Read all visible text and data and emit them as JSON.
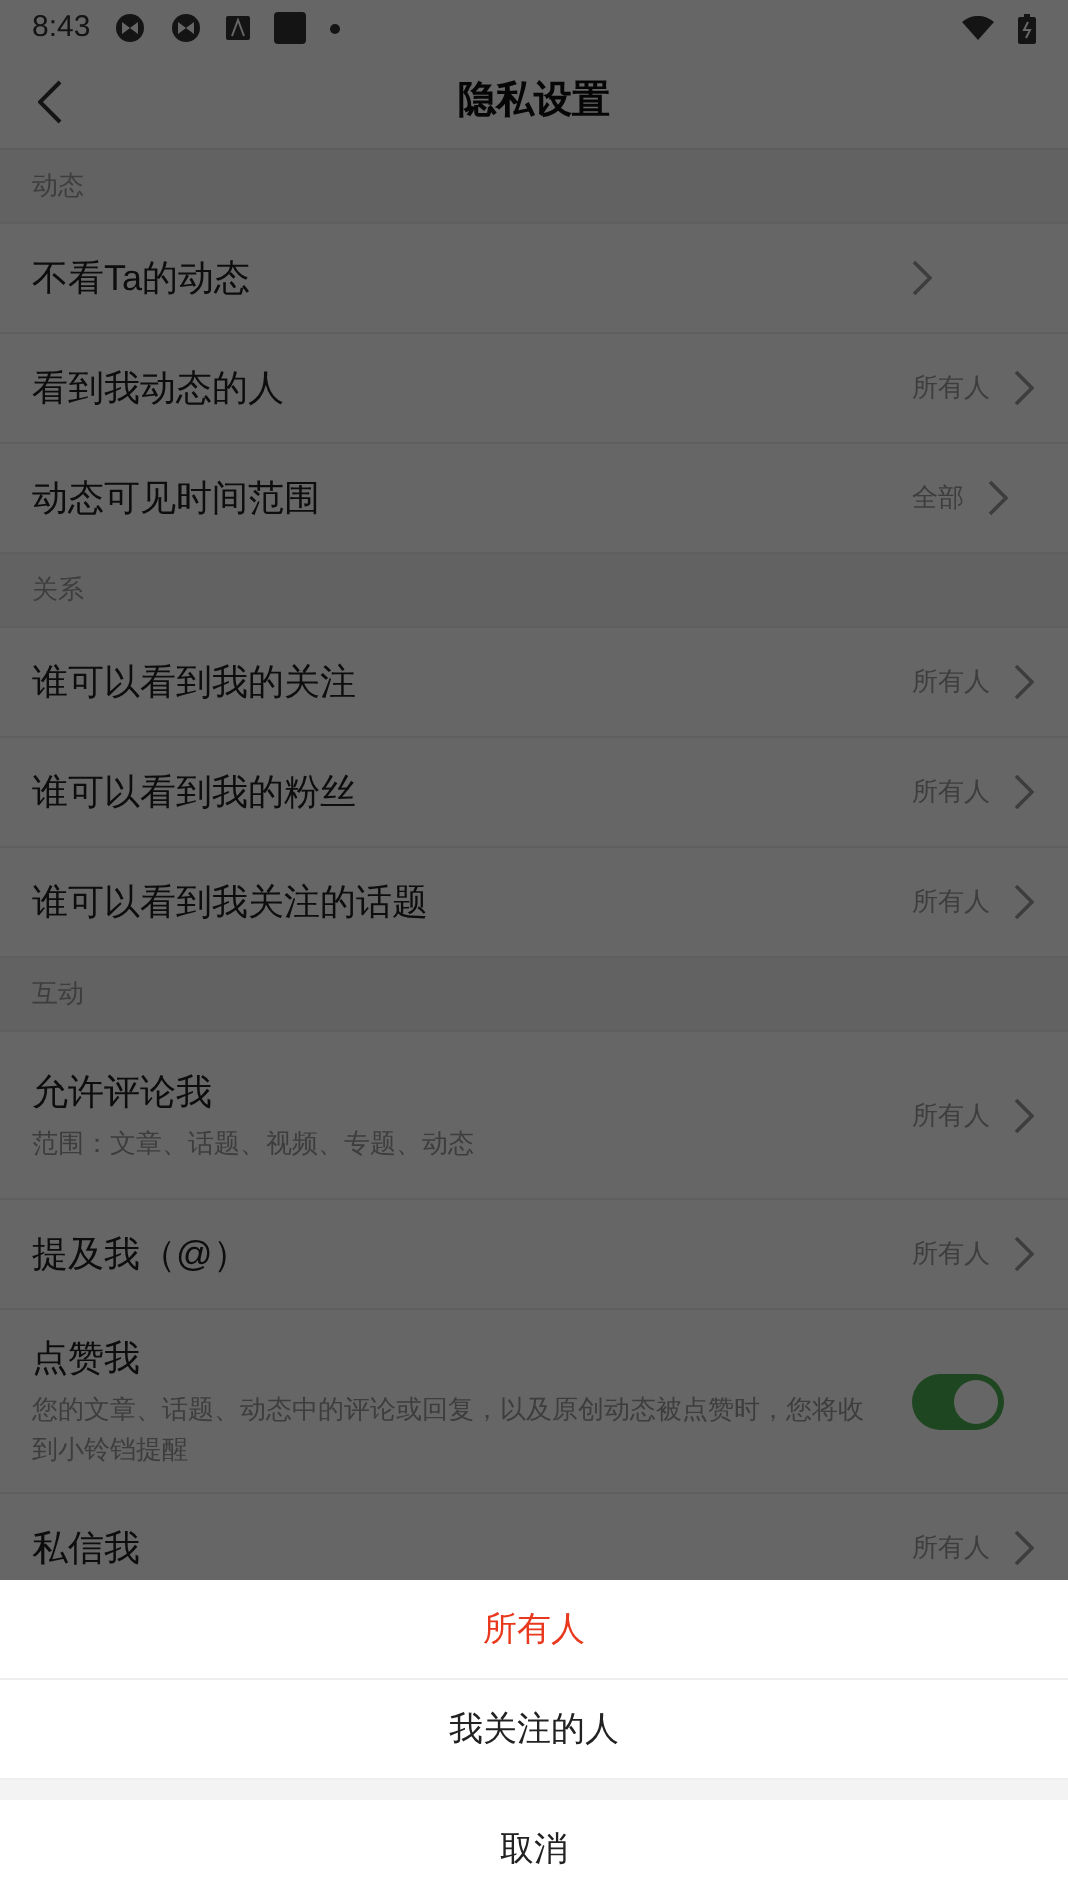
{
  "status_bar": {
    "time": "8:43"
  },
  "header": {
    "title": "隐私设置"
  },
  "sections": [
    {
      "title": "动态",
      "items": [
        {
          "kind": "link",
          "label": "不看Ta的动态"
        },
        {
          "kind": "link",
          "label": "看到我动态的人",
          "value": "所有人"
        },
        {
          "kind": "link",
          "label": "动态可见时间范围",
          "value": "全部"
        }
      ]
    },
    {
      "title": "关系",
      "items": [
        {
          "kind": "link",
          "label": "谁可以看到我的关注",
          "value": "所有人"
        },
        {
          "kind": "link",
          "label": "谁可以看到我的粉丝",
          "value": "所有人"
        },
        {
          "kind": "link",
          "label": "谁可以看到我关注的话题",
          "value": "所有人"
        }
      ]
    },
    {
      "title": "互动",
      "items": [
        {
          "kind": "link",
          "label": "允许评论我",
          "description": "范围：文章、话题、视频、专题、动态",
          "value": "所有人"
        },
        {
          "kind": "link",
          "label": "提及我（@）",
          "value": "所有人"
        },
        {
          "kind": "toggle",
          "label": "点赞我",
          "description": "您的文章、话题、动态中的评论或回复，以及原创动态被点赞时，您将收到小铃铛提醒",
          "on": true
        },
        {
          "kind": "link",
          "label": "私信我",
          "value": "所有人"
        }
      ]
    }
  ],
  "sheet": {
    "options": [
      {
        "label": "所有人",
        "selected": true
      },
      {
        "label": "我关注的人",
        "selected": false
      }
    ],
    "cancel": "取消"
  }
}
